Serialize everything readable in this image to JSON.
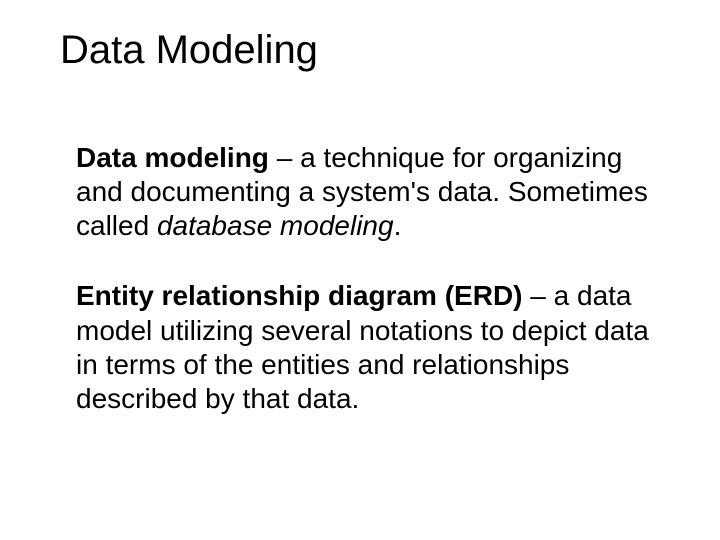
{
  "title": "Data Modeling",
  "def1": {
    "term": "Data modeling",
    "sep": " – ",
    "text1": "a technique for organizing and documenting a system's data. Sometimes called ",
    "italic": "database modeling",
    "period": "."
  },
  "def2": {
    "term": "Entity relationship diagram (ERD)",
    "sep": " – ",
    "text1": "a data model utilizing several notations to depict data in terms of the entities and relationships described by that data."
  }
}
